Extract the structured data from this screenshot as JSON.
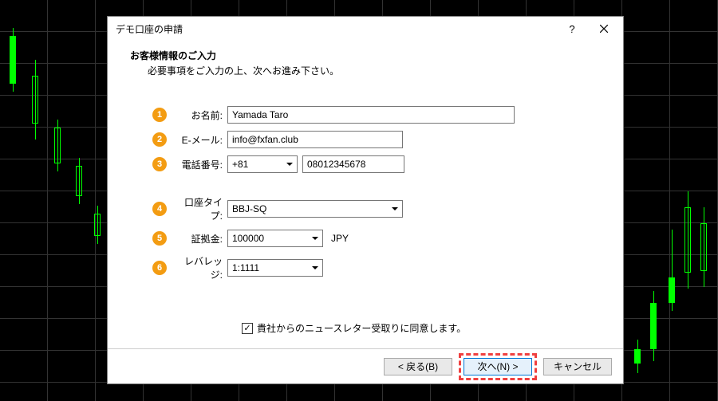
{
  "dialog": {
    "title": "デモ口座の申請",
    "header": {
      "title": "お客様情報のご入力",
      "subtitle": "必要事項をご入力の上、次へお進み下さい。"
    },
    "fields": {
      "name": {
        "label": "お名前:",
        "value": "Yamada Taro"
      },
      "email": {
        "label": "E-メール:",
        "value": "info@fxfan.club"
      },
      "phone": {
        "label": "電話番号:",
        "cc": "+81",
        "value": "08012345678"
      },
      "account_type": {
        "label": "口座タイプ:",
        "value": "BBJ-SQ"
      },
      "deposit": {
        "label": "証拠金:",
        "value": "100000",
        "currency": "JPY"
      },
      "leverage": {
        "label": "レバレッジ:",
        "value": "1:1111"
      }
    },
    "badges": {
      "n1": "1",
      "n2": "2",
      "n3": "3",
      "n4": "4",
      "n5": "5",
      "n6": "6"
    },
    "consent": {
      "checked": "✓",
      "label": "貴社からのニュースレター受取りに同意します。"
    },
    "buttons": {
      "back": "< 戻る(B)",
      "next": "次へ(N) >",
      "cancel": "キャンセル"
    }
  }
}
